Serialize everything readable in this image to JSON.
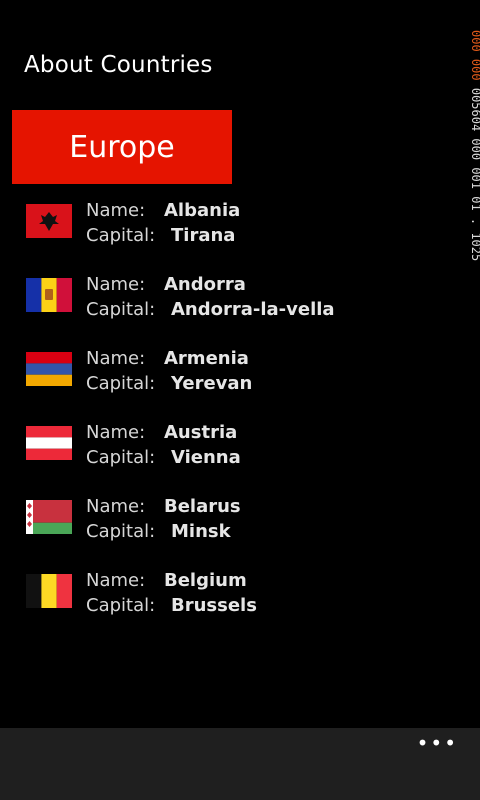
{
  "page": {
    "title": "About Countries"
  },
  "debug": {
    "line1": "000",
    "line2": "000",
    "line3": "005604 000 001 01 . 1025"
  },
  "region": {
    "label": "Europe"
  },
  "labels": {
    "name": "Name:",
    "capital": "Capital:"
  },
  "countries": [
    {
      "name": "Albania",
      "capital": "Tirana",
      "flag_icon": "albania-flag-icon"
    },
    {
      "name": "Andorra",
      "capital": "Andorra-la-vella",
      "flag_icon": "andorra-flag-icon"
    },
    {
      "name": "Armenia",
      "capital": "Yerevan",
      "flag_icon": "armenia-flag-icon"
    },
    {
      "name": "Austria",
      "capital": "Vienna",
      "flag_icon": "austria-flag-icon"
    },
    {
      "name": "Belarus",
      "capital": "Minsk",
      "flag_icon": "belarus-flag-icon"
    },
    {
      "name": "Belgium",
      "capital": "Brussels",
      "flag_icon": "belgium-flag-icon"
    }
  ],
  "app_bar": {
    "more_label": "•••"
  },
  "colors": {
    "accent": "#e51400",
    "background": "#000000",
    "app_bar": "#1f1f1f"
  }
}
